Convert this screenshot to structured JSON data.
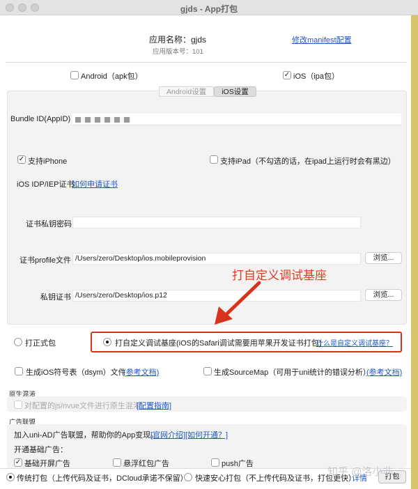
{
  "window": {
    "title": "gjds - App打包"
  },
  "header": {
    "app_name_label": "应用名称：gjds",
    "app_version_label": "应用版本号：101",
    "manifest_link": "修改manifest配置"
  },
  "platforms": {
    "android_label": "Android（apk包）",
    "android_checked": false,
    "ios_label": "iOS（ipa包）",
    "ios_checked": true
  },
  "tabs": [
    {
      "label": "Android设置",
      "active": false
    },
    {
      "label": "iOS设置",
      "active": true
    }
  ],
  "ios": {
    "bundle_id_label": "Bundle ID(AppID)",
    "bundle_id_value": "",
    "support_iphone_label": "支持iPhone",
    "support_iphone_checked": true,
    "support_ipad_label": "支持iPad（不勾选的话，在ipad上运行时会有黑边）",
    "support_ipad_checked": false,
    "cert_label": "iOS IDP/IEP证书",
    "cert_link": "如何申请证书",
    "private_key_password_label": "证书私钥密码",
    "private_key_password_value": "",
    "profile_label": "证书profile文件",
    "profile_value": "/Users/zero/Desktop/ios.mobileprovision",
    "private_cert_label": "私钥证书",
    "private_cert_value": "/Users/zero/Desktop/ios.p12",
    "browse_label": "浏览..."
  },
  "annotation": {
    "text": "打自定义调试基座",
    "color": "#e13b22"
  },
  "build_type": {
    "formal_label": "打正式包",
    "formal_selected": false,
    "custom_label": "打自定义调试基座(iOS的Safari调试需要用苹果开发证书打包)",
    "custom_selected": true,
    "custom_link": "什么是自定义调试基座？"
  },
  "options": {
    "dsym_label": "生成iOS符号表（dsym）文件",
    "dsym_link": "(参考文档)",
    "sourcemap_label": "生成SourceMap（可用于uni统计的错误分析）",
    "sourcemap_link": "(参考文档)"
  },
  "native_mix": {
    "section_title": "原生混淆",
    "option_label": "对配置的js/nvue文件进行原生混淆",
    "option_link": "[配置指南]"
  },
  "ad": {
    "section_title": "广告联盟",
    "intro": "加入uni-AD广告联盟，帮助你的App变现。",
    "link_intro": "[官网介绍]",
    "link_how": "[如何开通？]",
    "basic_title": "开通基础广告：",
    "items": [
      "基础开屏广告",
      "悬浮红包广告",
      "push广告"
    ],
    "items_checked": [
      true,
      false,
      false
    ]
  },
  "footer": {
    "traditional_label": "传统打包（上传代码及证书，DCloud承诺不保留）",
    "traditional_selected": true,
    "fast_label": "快速安心打包（不上传代码及证书，打包更快）",
    "fast_selected": false,
    "detail_link": "详情",
    "pack_button": "打包"
  },
  "watermark": "知乎 @洛小非"
}
